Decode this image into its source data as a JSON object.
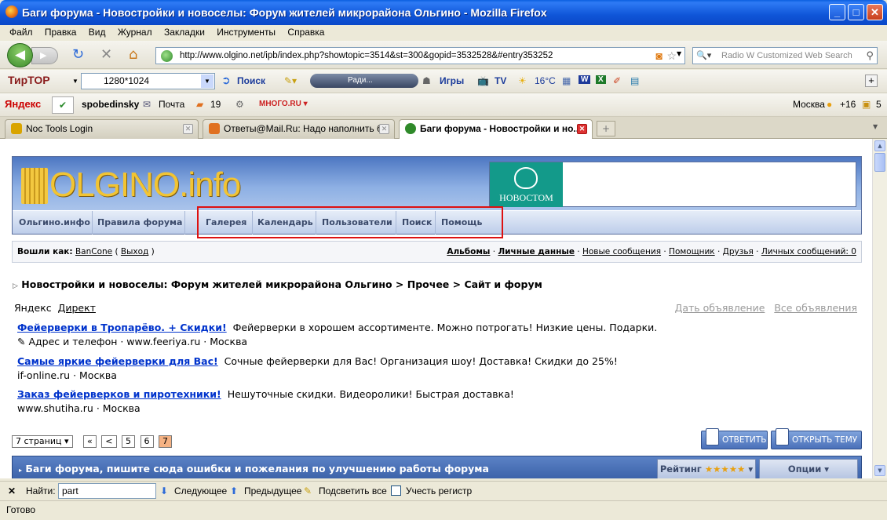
{
  "window": {
    "title": "Баги форума - Новостройки и новоселы: Форум жителей микрорайона Ольгино - Mozilla Firefox"
  },
  "menu": [
    "Файл",
    "Правка",
    "Вид",
    "Журнал",
    "Закладки",
    "Инструменты",
    "Справка"
  ],
  "nav": {
    "url": "http://www.olgino.net/ipb/index.php?showtopic=3514&st=300&gopid=3532528&#entry353252",
    "search_placeholder": "Radio W Customized Web Search"
  },
  "toolbar1": {
    "brand": "ТирТОР",
    "resolution": "1280*1024",
    "search": "Поиск",
    "radio": "Ради...",
    "games": "Игры",
    "tv": "TV",
    "temp": "16°C"
  },
  "toolbar2": {
    "yandex": "Яндекс",
    "user": "spobedinsky",
    "mail": "Почта",
    "mail_count": "19",
    "city": "Москва",
    "weather": "+16",
    "count": "5"
  },
  "tabs": [
    {
      "label": "Noc Tools Login",
      "icon_color": "#d9a400"
    },
    {
      "label": "Ответы@Mail.Ru: Надо наполнить б...",
      "icon_color": "#e07020"
    },
    {
      "label": "Баги форума - Новостройки и но...",
      "icon_color": "#2f8a2a"
    }
  ],
  "forum": {
    "logo": "OLGINO.info",
    "banner": "НОВОСТОМ",
    "nav": [
      "Ольгино.инфо",
      "Правила форума",
      "Галерея",
      "Календарь",
      "Пользователи",
      "Поиск",
      "Помощь"
    ],
    "userbar": {
      "logged_in_as": "Вошли как:",
      "user": "BanCone",
      "logout": "Выход",
      "links": [
        "Альбомы",
        "Личные данные",
        "Новые сообщения",
        "Помощник",
        "Друзья",
        "Личных сообщений: 0"
      ]
    },
    "breadcrumb": "Новостройки и новоселы: Форум жителей микрорайона Ольгино > Прочее > Сайт и форум",
    "ads": {
      "brand_a": "Яндекс",
      "brand_b": "Директ",
      "place_ad": "Дать объявление",
      "all_ads": "Все объявления",
      "items": [
        {
          "title": "Фейерверки в Тропарёво. + Скидки!",
          "text": "Фейерверки в хорошем ассортименте. Можно потрогать! Низкие цены. Подарки.",
          "meta": "Адрес и телефон · www.feeriya.ru · Москва"
        },
        {
          "title": "Самые яркие фейерверки для Вас!",
          "text": "Сочные фейерверки для Вас! Организация шоу! Доставка! Скидки до 25%!",
          "meta": "if-online.ru · Москва"
        },
        {
          "title": "Заказ фейерверков и пиротехники!",
          "text": "Нешуточные скидки. Видеоролики! Быстрая доставка!",
          "meta": "www.shutiha.ru · Москва"
        }
      ]
    },
    "pager": {
      "label": "7 страниц",
      "first": "«",
      "prev": "<",
      "pages": [
        "5",
        "6",
        "7"
      ],
      "current": "7"
    },
    "reply_btn": "ОТВЕТИТЬ",
    "newtopic_btn": "ОТКРЫТЬ ТЕМУ",
    "topic_title": "Баги форума, пишите сюда ошибки и пожелания по улучшению работы форума",
    "rating": "Рейтинг",
    "options": "Опции"
  },
  "findbar": {
    "label": "Найти:",
    "value": "part",
    "next": "Следующее",
    "prev": "Предыдущее",
    "highlight": "Подсветить все",
    "match_case": "Учесть регистр"
  },
  "status": "Готово"
}
